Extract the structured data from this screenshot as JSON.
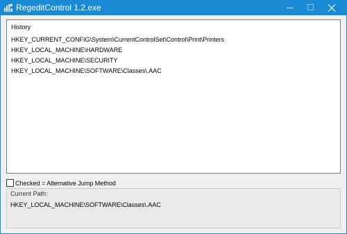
{
  "window": {
    "title": "RegeditControl 1.2.exe",
    "icon": "regedit-app-icon",
    "controls": [
      "minimize-icon",
      "maximize-icon",
      "close-icon"
    ],
    "accent_color": "#1a8ad4"
  },
  "history": {
    "header": "History",
    "items": [
      "HKEY_CURRENT_CONFIG\\System\\CurrentControlSet\\Control\\Print\\Printers",
      "HKEY_LOCAL_MACHINE\\HARDWARE",
      "HKEY_LOCAL_MACHINE\\SECURITY",
      "HKEY_LOCAL_MACHINE\\SOFTWARE\\Classes\\.AAC"
    ]
  },
  "options": {
    "alt_jump_label": "Checked = Alternative Jump Method",
    "alt_jump_checked": false
  },
  "current_path": {
    "label": "Current Path:",
    "value": "HKEY_LOCAL_MACHINE\\SOFTWARE\\Classes\\.AAC"
  }
}
